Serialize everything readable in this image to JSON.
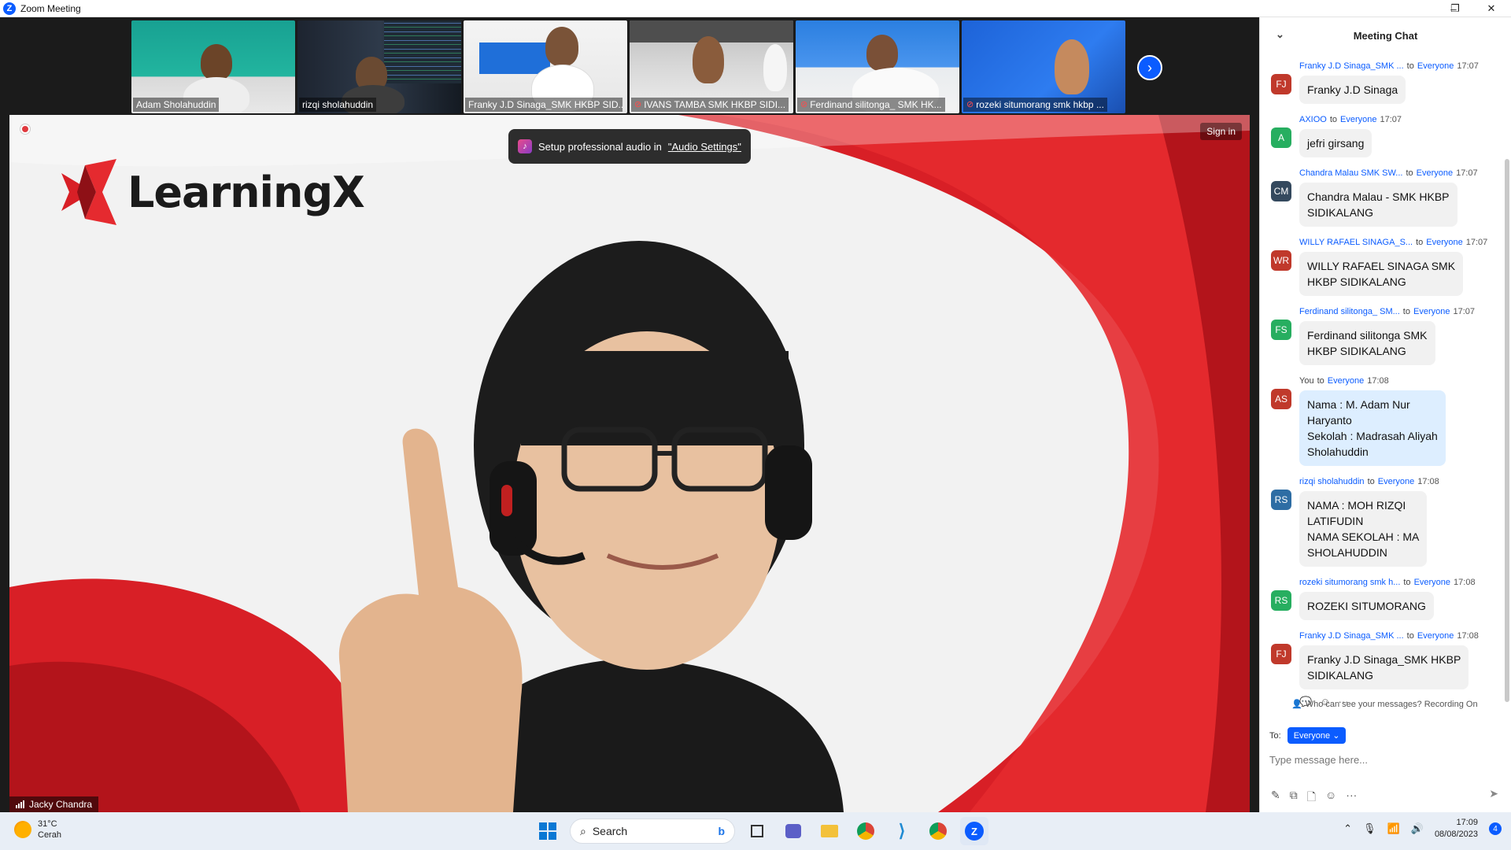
{
  "window": {
    "title": "Zoom Meeting",
    "minimize": "–",
    "restore": "❐",
    "close": "✕"
  },
  "filmstrip": {
    "participants": [
      {
        "name": "Adam Sholahuddin",
        "muted": false
      },
      {
        "name": "rizqi sholahuddin",
        "muted": false
      },
      {
        "name": "Franky J.D Sinaga_SMK HKBP SID...",
        "muted": false
      },
      {
        "name": "IVANS TAMBA SMK HKBP SIDI...",
        "muted": true
      },
      {
        "name": "Ferdinand silitonga_ SMK HK...",
        "muted": true
      },
      {
        "name": "rozeki situmorang smk hkbp ...",
        "muted": true
      }
    ],
    "next_icon": "›"
  },
  "speaker": {
    "name": "Jacky Chandra",
    "logo_text": "LearningX",
    "sign_in": "Sign in",
    "toast_text": "Setup professional audio in",
    "toast_link": "\"Audio Settings\""
  },
  "chat": {
    "title": "Meeting Chat",
    "collapse_icon": "⌄",
    "to_word": "to",
    "messages": [
      {
        "initials": "FJ",
        "color": "#c0392b",
        "sender": "Franky J.D Sinaga_SMK ...",
        "recipient": "Everyone",
        "time": "17:07",
        "text": "Franky J.D Sinaga",
        "mine": false
      },
      {
        "initials": "A",
        "color": "#27ae60",
        "sender": "AXIOO",
        "recipient": "Everyone",
        "time": "17:07",
        "text": "jefri girsang",
        "mine": false
      },
      {
        "initials": "CM",
        "color": "#34495e",
        "sender": "Chandra Malau SMK SW...",
        "recipient": "Everyone",
        "time": "17:07",
        "text": "Chandra Malau - SMK HKBP\nSIDIKALANG",
        "mine": false
      },
      {
        "initials": "WR",
        "color": "#c0392b",
        "sender": "WILLY RAFAEL SINAGA_S...",
        "recipient": "Everyone",
        "time": "17:07",
        "text": "WILLY RAFAEL SINAGA   SMK\nHKBP SIDIKALANG",
        "mine": false
      },
      {
        "initials": "FS",
        "color": "#27ae60",
        "sender": "Ferdinand silitonga_ SM...",
        "recipient": "Everyone",
        "time": "17:07",
        "text": "Ferdinand silitonga SMK\nHKBP SIDIKALANG",
        "mine": false
      },
      {
        "initials": "AS",
        "color": "#c0392b",
        "sender": "You",
        "recipient": "Everyone",
        "time": "17:08",
        "text": "Nama : M. Adam Nur\nHaryanto\nSekolah : Madrasah Aliyah\nSholahuddin",
        "mine": true
      },
      {
        "initials": "RS",
        "color": "#2e6da4",
        "sender": "rizqi sholahuddin",
        "recipient": "Everyone",
        "time": "17:08",
        "text": "NAMA : MOH RIZQI\nLATIFUDIN\nNAMA SEKOLAH : MA\nSHOLAHUDDIN",
        "mine": false
      },
      {
        "initials": "RS",
        "color": "#27ae60",
        "sender": "rozeki situmorang smk h...",
        "recipient": "Everyone",
        "time": "17:08",
        "text": "ROZEKI SITUMORANG",
        "mine": false
      },
      {
        "initials": "FJ",
        "color": "#c0392b",
        "sender": "Franky J.D Sinaga_SMK ...",
        "recipient": "Everyone",
        "time": "17:08",
        "text": "Franky J.D Sinaga_SMK HKBP\nSIDIKALANG",
        "mine": false
      }
    ],
    "reactions": [
      "💬",
      "☺",
      "···"
    ],
    "notice": "Who can see your messages? Recording On",
    "to_label": "To:",
    "to_value": "Everyone",
    "input_placeholder": "Type message here...",
    "tools": [
      "✎",
      "⧉",
      "🗋",
      "☺",
      "···"
    ],
    "send_icon": "➤"
  },
  "taskbar": {
    "weather_temp": "31°C",
    "weather_desc": "Cerah",
    "search_label": "Search",
    "time": "17:09",
    "date": "08/08/2023",
    "notification_count": "4"
  }
}
